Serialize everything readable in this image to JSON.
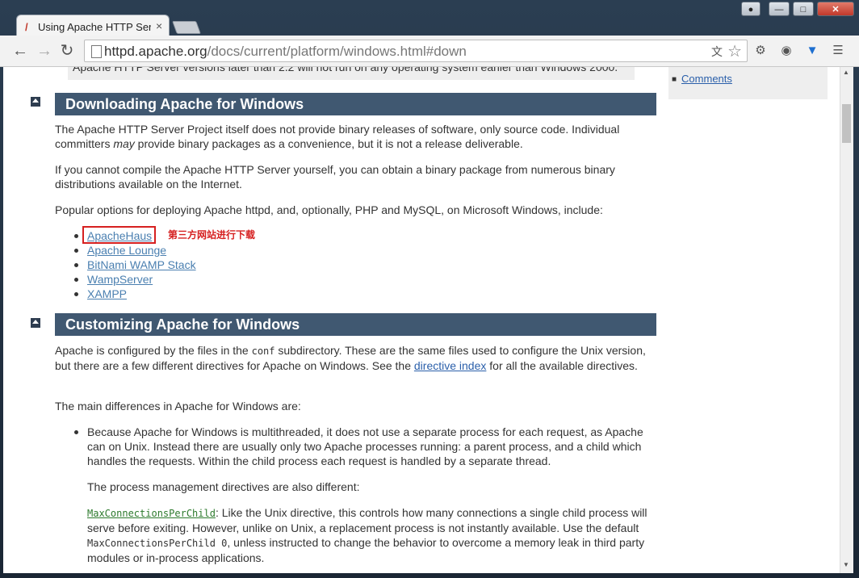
{
  "browser": {
    "tab_title": "Using Apache HTTP Ser",
    "url_host": "httpd.apache.org",
    "url_path": "/docs/current/platform/windows.html#down",
    "icons": [
      "back-icon",
      "forward-icon",
      "reload-icon",
      "page-icon",
      "translate-icon",
      "star-icon",
      "extension-icon",
      "extension-icon",
      "shield-icon",
      "menu-icon"
    ]
  },
  "page": {
    "top_note": "Apache HTTP Server versions later than 2.2 will not run on any operating system earlier than Windows 2000.",
    "sidebar_link": "Comments",
    "section1": {
      "title": "Downloading Apache for Windows",
      "p1_a": "The Apache HTTP Server Project itself does not provide binary releases of software, only source code. Individual committers ",
      "p1_em": "may",
      "p1_b": " provide binary packages as a convenience, but it is not a release deliverable.",
      "p2": "If you cannot compile the Apache HTTP Server yourself, you can obtain a binary package from numerous binary distributions available on the Internet.",
      "p3": "Popular options for deploying Apache httpd, and, optionally, PHP and MySQL, on Microsoft Windows, include:",
      "links": [
        "ApacheHaus",
        "Apache Lounge",
        "BitNami WAMP Stack",
        "WampServer",
        "XAMPP"
      ],
      "annotation": "第三方网站进行下载"
    },
    "section2": {
      "title": "Customizing Apache for Windows",
      "p1_a": "Apache is configured by the files in the ",
      "p1_code": "conf",
      "p1_b": " subdirectory. These are the same files used to configure the Unix version, but there are a few different directives for Apache on Windows. See the ",
      "p1_link": "directive index",
      "p1_c": " for all the available directives.",
      "p2": "The main differences in Apache for Windows are:",
      "bullet1": "Because Apache for Windows is multithreaded, it does not use a separate process for each request, as Apache can on Unix. Instead there are usually only two Apache processes running: a parent process, and a child which handles the requests. Within the child process each request is handled by a separate thread.",
      "sub1": "The process management directives are also different:",
      "directive_link": "MaxConnectionsPerChild",
      "sub2_a": ": Like the Unix directive, this controls how many connections a single child process will serve before exiting. However, unlike on Unix, a replacement process is not instantly available. Use the default ",
      "sub2_code": "MaxConnectionsPerChild 0",
      "sub2_b": ", unless instructed to change the behavior to overcome a memory leak in third party modules or in-process applications."
    }
  }
}
